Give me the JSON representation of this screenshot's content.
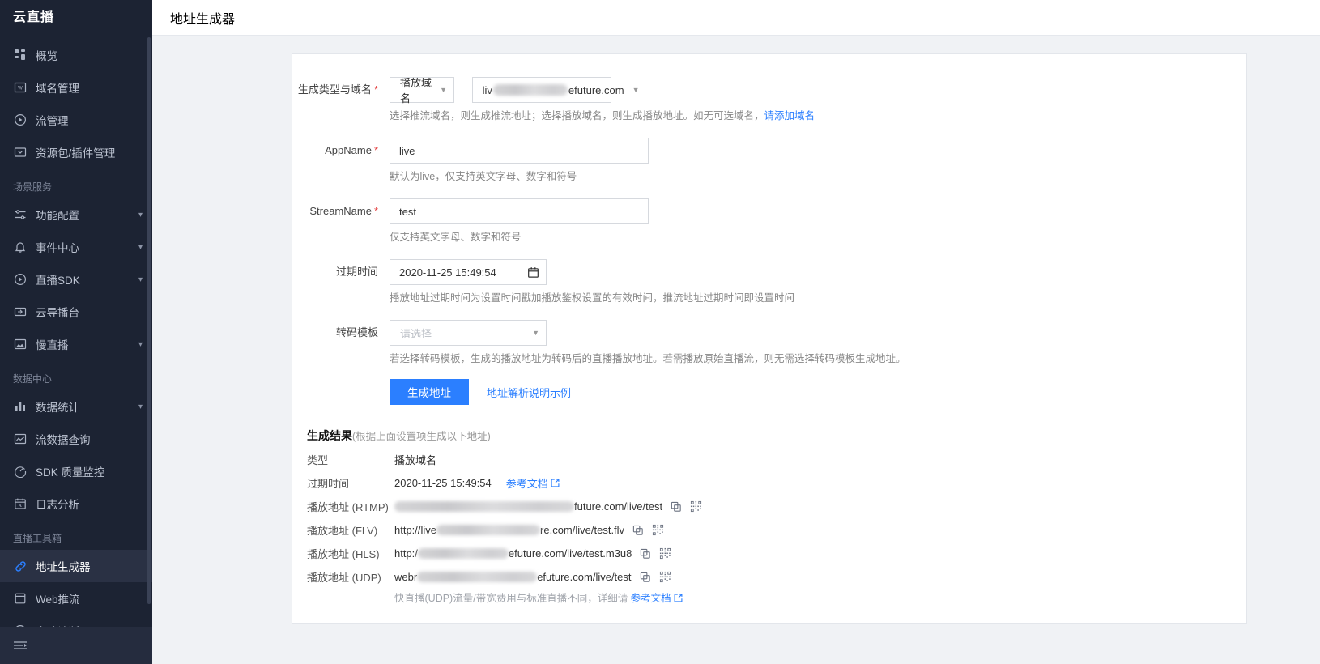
{
  "sidebar": {
    "brand": "云直播",
    "items": [
      {
        "label": "概览",
        "icon": "grid-icon",
        "type": "item"
      },
      {
        "label": "域名管理",
        "icon": "domain-icon",
        "type": "item"
      },
      {
        "label": "流管理",
        "icon": "play-circle-icon",
        "type": "item"
      },
      {
        "label": "资源包/插件管理",
        "icon": "package-icon",
        "type": "item"
      },
      {
        "label": "场景服务",
        "type": "group"
      },
      {
        "label": "功能配置",
        "icon": "sliders-icon",
        "type": "item",
        "expandable": true
      },
      {
        "label": "事件中心",
        "icon": "bell-icon",
        "type": "item",
        "expandable": true
      },
      {
        "label": "直播SDK",
        "icon": "play-circle-icon",
        "type": "item",
        "expandable": true
      },
      {
        "label": "云导播台",
        "icon": "broadcast-icon",
        "type": "item"
      },
      {
        "label": "慢直播",
        "icon": "image-icon",
        "type": "item",
        "expandable": true
      },
      {
        "label": "数据中心",
        "type": "group"
      },
      {
        "label": "数据统计",
        "icon": "bar-chart-icon",
        "type": "item",
        "expandable": true
      },
      {
        "label": "流数据查询",
        "icon": "chart-area-icon",
        "type": "item"
      },
      {
        "label": "SDK 质量监控",
        "icon": "gauge-icon",
        "type": "item"
      },
      {
        "label": "日志分析",
        "icon": "calendar-clock-icon",
        "type": "item"
      },
      {
        "label": "直播工具箱",
        "type": "group"
      },
      {
        "label": "地址生成器",
        "icon": "link-icon",
        "type": "item",
        "active": true
      },
      {
        "label": "Web推流",
        "icon": "window-icon",
        "type": "item"
      },
      {
        "label": "自助诊断",
        "icon": "search-circle-icon",
        "type": "item"
      }
    ],
    "collapse_icon": "collapse-menu-icon"
  },
  "topbar": {
    "title": "地址生成器"
  },
  "form": {
    "type_domain": {
      "label": "生成类型与域名",
      "required": true,
      "type_value": "播放域名",
      "domain_prefix": "liv",
      "domain_suffix": "efuture.com",
      "helper_text": "选择推流域名，则生成推流地址；选择播放域名，则生成播放地址。如无可选域名，",
      "helper_link": "请添加域名"
    },
    "appname": {
      "label": "AppName",
      "required": true,
      "value": "live",
      "placeholder": "live",
      "helper": "默认为live，仅支持英文字母、数字和符号"
    },
    "streamname": {
      "label": "StreamName",
      "required": true,
      "value": "test",
      "placeholder": "test",
      "helper": "仅支持英文字母、数字和符号"
    },
    "expire": {
      "label": "过期时间",
      "value": "2020-11-25 15:49:54",
      "calendar_icon": "calendar-icon",
      "helper": "播放地址过期时间为设置时间戳加播放鉴权设置的有效时间，推流地址过期时间即设置时间"
    },
    "transcode": {
      "label": "转码模板",
      "placeholder": "请选择",
      "helper": "若选择转码模板，生成的播放地址为转码后的直播播放地址。若需播放原始直播流，则无需选择转码模板生成地址。"
    },
    "actions": {
      "generate_label": "生成地址",
      "example_link": "地址解析说明示例"
    }
  },
  "results": {
    "title": "生成结果",
    "subtitle": "(根据上面设置项生成以下地址)",
    "rows": [
      {
        "label": "类型",
        "value": "播放域名",
        "redacted": false,
        "copy": false,
        "qr": false
      },
      {
        "label": "过期时间",
        "value": "2020-11-25 15:49:54",
        "redacted": false,
        "copy": false,
        "qr": false,
        "doc_link": "参考文档"
      },
      {
        "label": "播放地址 (RTMP)",
        "prefix": "",
        "suffix": "future.com/live/test",
        "redacted": true,
        "redact_width": 222,
        "copy": true,
        "qr": true
      },
      {
        "label": "播放地址 (FLV)",
        "prefix": "http://live",
        "suffix": "re.com/live/test.flv",
        "redacted": true,
        "redact_width": 128,
        "copy": true,
        "qr": true
      },
      {
        "label": "播放地址 (HLS)",
        "prefix": "http:/",
        "suffix": "efuture.com/live/test.m3u8",
        "redacted": true,
        "redact_width": 112,
        "copy": true,
        "qr": true
      },
      {
        "label": "播放地址 (UDP)",
        "prefix": "webr",
        "suffix": "efuture.com/live/test",
        "redacted": true,
        "redact_width": 148,
        "copy": true,
        "qr": true
      }
    ],
    "note_text": "快直播(UDP)流量/带宽费用与标准直播不同，详细请 ",
    "note_link": "参考文档",
    "copy_icon": "copy-icon",
    "qr_icon": "qrcode-icon",
    "external_icon": "external-link-icon"
  },
  "colors": {
    "accent": "#2b7fff",
    "sidebar_bg": "#1c2333",
    "sidebar_active": "#2a3144",
    "required_star": "#e54545",
    "page_bg": "#f0f2f5"
  }
}
